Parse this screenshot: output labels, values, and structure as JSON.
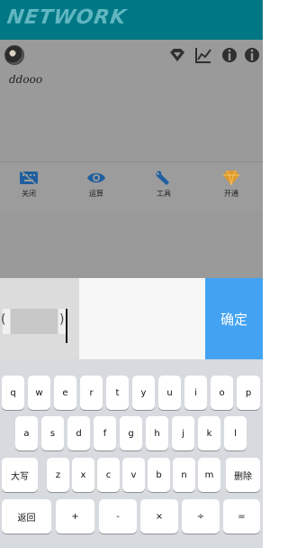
{
  "header": {
    "logo_text": "NETWORK"
  },
  "card": {
    "memo_text": "ddooo",
    "top_icons": [
      "diamond-icon",
      "line-chart-icon",
      "info-circle-icon",
      "info-circle-icon"
    ]
  },
  "toolbar": {
    "items": [
      {
        "label": "关闭",
        "icon": "keyboard-off-icon"
      },
      {
        "label": "运算",
        "icon": "eye-icon"
      },
      {
        "label": "工具",
        "icon": "wrench-icon"
      },
      {
        "label": "开通",
        "icon": "diamond-icon"
      }
    ]
  },
  "input": {
    "confirm_label": "确定"
  },
  "keyboard": {
    "row1": [
      "q",
      "w",
      "e",
      "r",
      "t",
      "y",
      "u",
      "i",
      "o",
      "p"
    ],
    "row2": [
      "a",
      "s",
      "d",
      "f",
      "g",
      "h",
      "j",
      "k",
      "l"
    ],
    "row3": [
      "大写",
      "z",
      "x",
      "c",
      "v",
      "b",
      "n",
      "m",
      "删除"
    ],
    "row4": [
      "返回",
      "+",
      "-",
      "×",
      "÷",
      "="
    ]
  },
  "colors": {
    "header": "#007785",
    "confirm": "#43a3f2",
    "toolbar_icon": "#1f5fa0",
    "diamond": "#e09a2b"
  }
}
